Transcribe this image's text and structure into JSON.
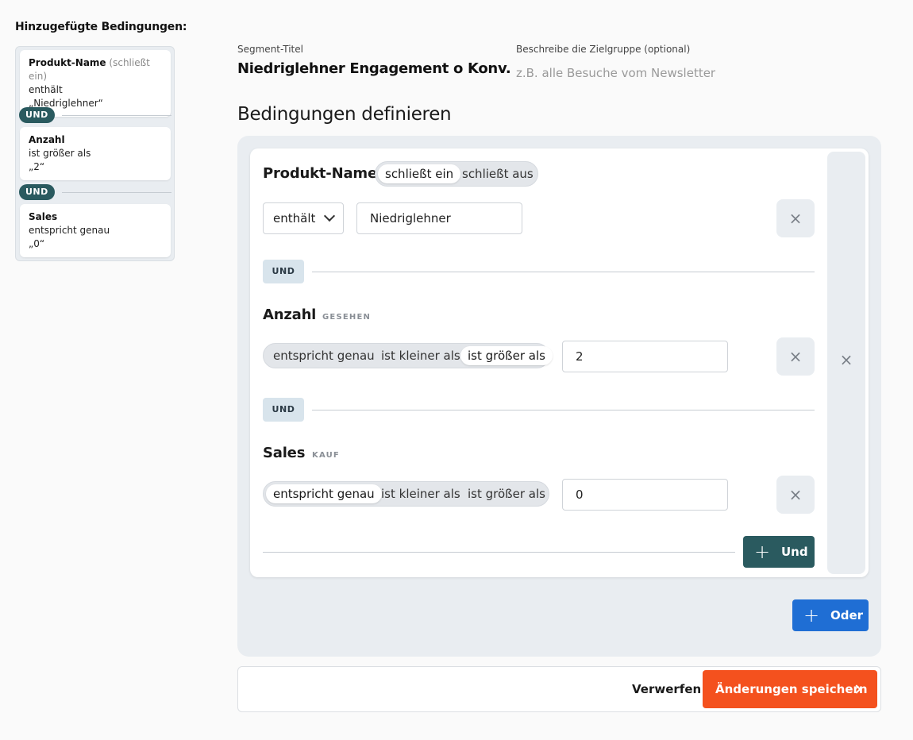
{
  "summary": {
    "title": "Hinzugefügte Bedingungen:",
    "items": [
      {
        "name": "Produkt-Name",
        "qualifier": "(schließt ein)",
        "operator": "enthält",
        "value": "„Niedriglehner“"
      },
      {
        "name": "Anzahl",
        "qualifier": "",
        "operator": "ist größer als",
        "value": "„2“"
      },
      {
        "name": "Sales",
        "qualifier": "",
        "operator": "entspricht genau",
        "value": "„0“"
      }
    ],
    "separator_label": "UND"
  },
  "header": {
    "segment_title_label": "Segment-Titel",
    "segment_title_value": "Niedriglehner Engagement o Konv.",
    "description_label": "Beschreibe die Zielgruppe (optional)",
    "description_placeholder": "z.B. alle Besuche vom Newsletter"
  },
  "section_title": "Bedingungen definieren",
  "conditions": {
    "produkt": {
      "name": "Produkt-Name",
      "toggle": [
        "schließt ein",
        "schließt aus"
      ],
      "toggle_selected": "schließt ein",
      "operator": "enthält",
      "value": "Niedriglehner"
    },
    "anzahl": {
      "name": "Anzahl",
      "tag": "GESEHEN",
      "options": [
        "entspricht genau",
        "ist kleiner als",
        "ist größer als"
      ],
      "selected": "ist größer als",
      "value": "2"
    },
    "sales": {
      "name": "Sales",
      "tag": "KAUF",
      "options": [
        "entspricht genau",
        "ist kleiner als",
        "ist größer als"
      ],
      "selected": "entspricht genau",
      "value": "0"
    },
    "und_label": "UND",
    "remove_icon": "×"
  },
  "buttons": {
    "und": "Und",
    "oder": "Oder",
    "discard": "Verwerfen",
    "save": "Änderungen speichern",
    "plus": "+"
  },
  "colors": {
    "teal": "#2a5a5f",
    "blue": "#1f6ed4",
    "orange": "#f4511e"
  }
}
